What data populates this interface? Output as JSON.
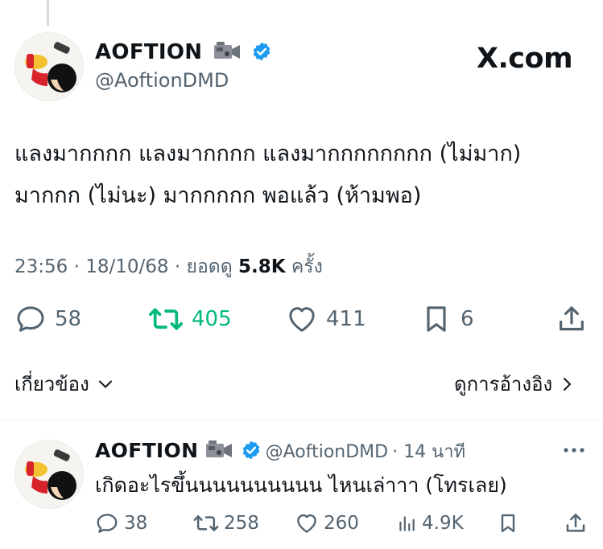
{
  "main": {
    "display_name": "AOFTION",
    "handle": "@AoftionDMD",
    "site_label": "X.com",
    "text_line1": "แลงมากกกก แลงมากกกก แลงมากกกกกกกก (ไม่มาก)",
    "text_line2": "มากกก (ไม่นะ) มากกกกก พอแล้ว (ห้ามพอ)",
    "time": "23:56",
    "date": "18/10/68",
    "views_prefix": "ยอดดู",
    "views": "5.8K",
    "views_suffix": "ครั้ง",
    "replies": "58",
    "reposts": "405",
    "likes": "411",
    "bookmarks": "6"
  },
  "links": {
    "related": "เกี่ยวข้อง",
    "view_quotes": "ดูการอ้างอิง"
  },
  "reply": {
    "display_name": "AOFTION",
    "handle": "@AoftionDMD",
    "time": "14 นาที",
    "text": "เกิดอะไรขึ้นนนนนนนนนน ไหนเล่าาา (โทรเลย)",
    "replies": "38",
    "reposts": "258",
    "likes": "260",
    "views": "4.9K"
  },
  "colors": {
    "verified": "#1d9bf0",
    "repost_active": "#00ba7c",
    "muted": "#536471"
  }
}
